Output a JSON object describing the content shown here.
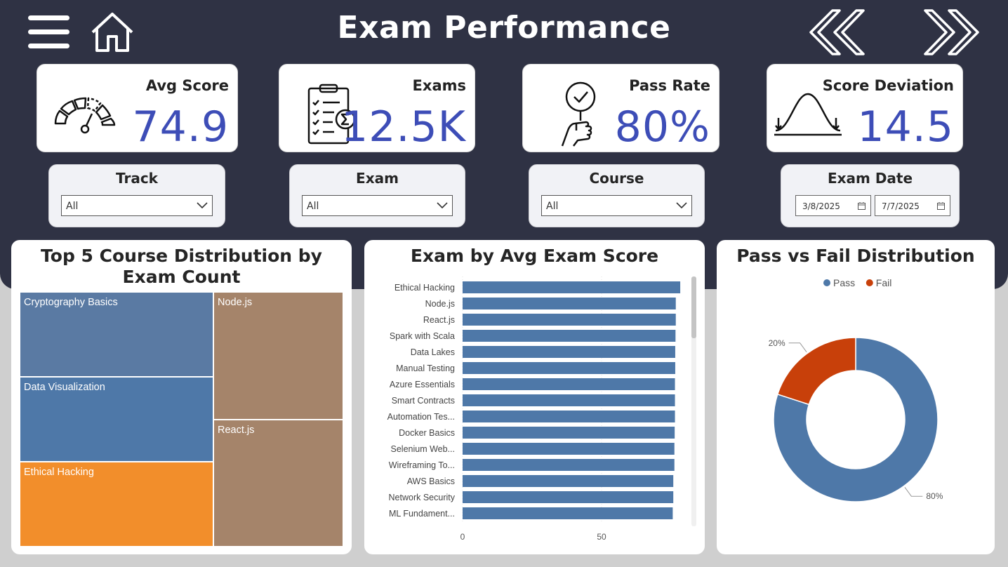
{
  "header": {
    "title": "Exam Performance",
    "colors": {
      "background": "#2f3244",
      "kpi_value": "#3d4db7"
    },
    "icons": [
      "hamburger-menu-icon",
      "home-icon",
      "back-double-chevron-icon",
      "forward-double-chevron-icon"
    ]
  },
  "kpis": {
    "avg_score": {
      "label": "Avg Score",
      "value": "74.9",
      "icon": "gauge-icon"
    },
    "exams": {
      "label": "Exams",
      "value": "12.5K",
      "icon": "checklist-sum-icon"
    },
    "pass_rate": {
      "label": "Pass Rate",
      "value": "80%",
      "icon": "hand-check-icon"
    },
    "score_deviation": {
      "label": "Score Deviation",
      "value": "14.5",
      "icon": "bell-curve-icon"
    }
  },
  "slicers": {
    "track": {
      "title": "Track",
      "value": "All"
    },
    "exam": {
      "title": "Exam",
      "value": "All"
    },
    "course": {
      "title": "Course",
      "value": "All"
    },
    "exam_date": {
      "title": "Exam Date",
      "start": "3/8/2025",
      "end": "7/7/2025"
    }
  },
  "treemap": {
    "title": "Top 5 Course Distribution by Exam Count",
    "tiles": [
      {
        "label": "Cryptography Basics",
        "color": "#5a7aa3"
      },
      {
        "label": "Data Visualization",
        "color": "#4e78a8"
      },
      {
        "label": "Ethical Hacking",
        "color": "#f28e2b"
      },
      {
        "label": "Node.js",
        "color": "#a5846a"
      },
      {
        "label": "React.js",
        "color": "#a5846a"
      }
    ]
  },
  "bar_chart": {
    "title": "Exam by Avg Exam Score"
  },
  "donut": {
    "title": "Pass vs Fail Distribution"
  },
  "chart_data": [
    {
      "type": "bar",
      "orientation": "horizontal",
      "title": "Exam by Avg Exam Score",
      "categories": [
        "Ethical Hacking",
        "Node.js",
        "React.js",
        "Spark with Scala",
        "Data Lakes",
        "Manual Testing",
        "Azure Essentials",
        "Smart Contracts",
        "Automation Tes...",
        "Docker Basics",
        "Selenium Web...",
        "Wireframing To...",
        "AWS Basics",
        "Network Security",
        "ML Fundament..."
      ],
      "values": [
        78.3,
        76.7,
        76.7,
        76.6,
        76.5,
        76.5,
        76.4,
        76.4,
        76.4,
        76.3,
        76.2,
        76.2,
        75.8,
        75.8,
        75.6
      ],
      "xlim": [
        0,
        80
      ],
      "xticks": [
        0,
        50
      ],
      "grid": true,
      "color": "#4e78a8"
    },
    {
      "type": "pie",
      "variant": "donut",
      "title": "Pass vs Fail Distribution",
      "legend": "top",
      "slices": [
        {
          "name": "Pass",
          "value": 80,
          "label": "80%",
          "color": "#4e78a8"
        },
        {
          "name": "Fail",
          "value": 20,
          "label": "20%",
          "color": "#c8400a"
        }
      ]
    }
  ]
}
